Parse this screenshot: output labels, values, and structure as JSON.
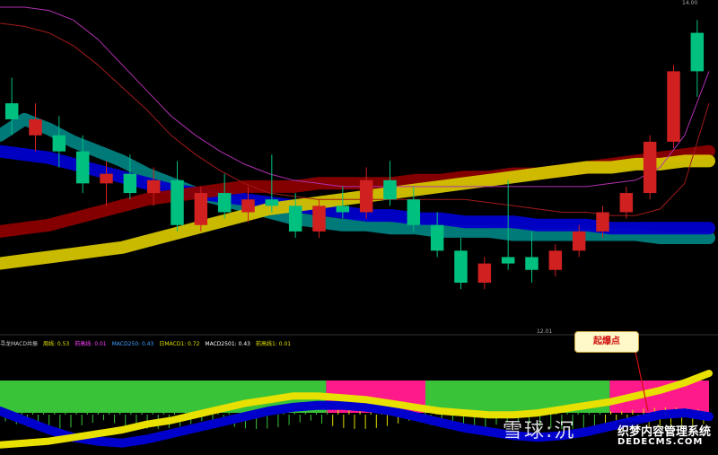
{
  "chart_data": [
    {
      "type": "line",
      "panel": "price",
      "title": "",
      "xlabel": "",
      "ylabel": "",
      "price_labels": {
        "high": "14.00",
        "low": "12.01"
      },
      "bands": [
        {
          "color": "#008080",
          "values": [
            60,
            65,
            62,
            58,
            55,
            52,
            48,
            45,
            42,
            40,
            38,
            36,
            34,
            33,
            32,
            32,
            31,
            31,
            30,
            30,
            30,
            29,
            29,
            29,
            29,
            29,
            29,
            28,
            28,
            28
          ]
        },
        {
          "color": "#0000cc",
          "values": [
            55,
            54,
            53,
            51,
            49,
            47,
            45,
            43,
            42,
            41,
            40,
            39,
            38,
            37,
            36,
            35,
            35,
            34,
            34,
            33,
            33,
            33,
            32,
            32,
            32,
            31,
            31,
            31,
            31,
            31
          ]
        },
        {
          "color": "#8b0000",
          "values": [
            30,
            31,
            32,
            34,
            36,
            38,
            40,
            41,
            42,
            43,
            44,
            44,
            44,
            45,
            45,
            45,
            45,
            46,
            46,
            47,
            47,
            48,
            48,
            49,
            50,
            51,
            52,
            53,
            54,
            55
          ]
        },
        {
          "color": "#d4c400",
          "values": [
            20,
            21,
            22,
            23,
            24,
            25,
            27,
            29,
            31,
            33,
            35,
            37,
            38,
            39,
            40,
            41,
            42,
            43,
            44,
            45,
            46,
            47,
            48,
            49,
            50,
            50,
            51,
            51,
            52,
            52
          ]
        }
      ],
      "series": [
        {
          "color": "#b030b0",
          "values": [
            100,
            100,
            99,
            96,
            90,
            82,
            74,
            66,
            60,
            55,
            51,
            48,
            46,
            45,
            44,
            44,
            44,
            44,
            44,
            44,
            44,
            44,
            44,
            44,
            44,
            45,
            46,
            50,
            60,
            80
          ]
        },
        {
          "color": "#a01a1a",
          "values": [
            95,
            94,
            92,
            88,
            82,
            75,
            68,
            60,
            54,
            49,
            45,
            42,
            41,
            40,
            40,
            40,
            40,
            40,
            40,
            40,
            39,
            38,
            37,
            36,
            36,
            35,
            35,
            37,
            45,
            70
          ]
        }
      ],
      "candles": [
        {
          "c": "#00c080",
          "o": 70,
          "h": 78,
          "l": 60,
          "cl": 65
        },
        {
          "c": "#d02020",
          "o": 65,
          "h": 70,
          "l": 55,
          "cl": 60
        },
        {
          "c": "#00c080",
          "o": 60,
          "h": 66,
          "l": 50,
          "cl": 55
        },
        {
          "c": "#00c080",
          "o": 55,
          "h": 60,
          "l": 42,
          "cl": 45
        },
        {
          "c": "#d02020",
          "o": 45,
          "h": 52,
          "l": 38,
          "cl": 48
        },
        {
          "c": "#00c080",
          "o": 48,
          "h": 54,
          "l": 40,
          "cl": 42
        },
        {
          "c": "#d02020",
          "o": 42,
          "h": 50,
          "l": 38,
          "cl": 46
        },
        {
          "c": "#00c080",
          "o": 46,
          "h": 52,
          "l": 30,
          "cl": 32
        },
        {
          "c": "#d02020",
          "o": 32,
          "h": 44,
          "l": 30,
          "cl": 42
        },
        {
          "c": "#00c080",
          "o": 42,
          "h": 48,
          "l": 34,
          "cl": 36
        },
        {
          "c": "#d02020",
          "o": 36,
          "h": 44,
          "l": 33,
          "cl": 40
        },
        {
          "c": "#00c080",
          "o": 40,
          "h": 54,
          "l": 36,
          "cl": 38
        },
        {
          "c": "#00c080",
          "o": 38,
          "h": 42,
          "l": 28,
          "cl": 30
        },
        {
          "c": "#d02020",
          "o": 30,
          "h": 40,
          "l": 28,
          "cl": 38
        },
        {
          "c": "#00c080",
          "o": 38,
          "h": 44,
          "l": 34,
          "cl": 36
        },
        {
          "c": "#d02020",
          "o": 36,
          "h": 50,
          "l": 34,
          "cl": 46
        },
        {
          "c": "#00c080",
          "o": 46,
          "h": 52,
          "l": 38,
          "cl": 40
        },
        {
          "c": "#00c080",
          "o": 40,
          "h": 44,
          "l": 30,
          "cl": 32
        },
        {
          "c": "#00c080",
          "o": 32,
          "h": 36,
          "l": 22,
          "cl": 24
        },
        {
          "c": "#00c080",
          "o": 24,
          "h": 28,
          "l": 12,
          "cl": 14
        },
        {
          "c": "#d02020",
          "o": 14,
          "h": 22,
          "l": 12,
          "cl": 20
        },
        {
          "c": "#00c080",
          "o": 20,
          "h": 46,
          "l": 18,
          "cl": 22
        },
        {
          "c": "#00c080",
          "o": 22,
          "h": 30,
          "l": 14,
          "cl": 18
        },
        {
          "c": "#d02020",
          "o": 18,
          "h": 26,
          "l": 16,
          "cl": 24
        },
        {
          "c": "#d02020",
          "o": 24,
          "h": 32,
          "l": 22,
          "cl": 30
        },
        {
          "c": "#d02020",
          "o": 30,
          "h": 38,
          "l": 28,
          "cl": 36
        },
        {
          "c": "#d02020",
          "o": 36,
          "h": 44,
          "l": 34,
          "cl": 42
        },
        {
          "c": "#d02020",
          "o": 42,
          "h": 60,
          "l": 40,
          "cl": 58
        },
        {
          "c": "#d02020",
          "o": 58,
          "h": 82,
          "l": 56,
          "cl": 80
        },
        {
          "c": "#00c080",
          "o": 80,
          "h": 96,
          "l": 72,
          "cl": 92
        }
      ]
    },
    {
      "type": "area",
      "panel": "indicator",
      "title": "",
      "xlabel": "",
      "ylabel": "",
      "legend_items": [
        {
          "label": "寻龙MACD共振",
          "color": "#cccccc"
        },
        {
          "label": "周线: 0.53",
          "color": "#e0e000"
        },
        {
          "label": "前高线: 0.01",
          "color": "#ff40ff"
        },
        {
          "label": "MACD250: 0.43",
          "color": "#40a0ff"
        },
        {
          "label": "日MACD1: 0.72",
          "color": "#e0e000"
        },
        {
          "label": "MACD2501: 0.43",
          "color": "#ffffff"
        },
        {
          "label": "前高线1: 0.01",
          "color": "#e0e000"
        }
      ],
      "zones": [
        {
          "color": "#39c339",
          "from": 0,
          "to": 0.46
        },
        {
          "color": "#ff1a8c",
          "from": 0.46,
          "to": 0.6
        },
        {
          "color": "#39c339",
          "from": 0.6,
          "to": 0.86
        },
        {
          "color": "#ff1a8c",
          "from": 0.86,
          "to": 1
        }
      ],
      "blue_line": [
        40,
        30,
        20,
        12,
        8,
        6,
        10,
        16,
        22,
        28,
        34,
        40,
        44,
        46,
        46,
        44,
        40,
        34,
        28,
        22,
        18,
        14,
        12,
        14,
        18,
        24,
        30,
        36,
        38,
        34
      ],
      "yellow_line": [
        4,
        6,
        8,
        12,
        16,
        20,
        26,
        30,
        36,
        42,
        48,
        52,
        56,
        56,
        54,
        52,
        48,
        44,
        40,
        38,
        36,
        36,
        38,
        42,
        46,
        50,
        56,
        62,
        70,
        80
      ]
    }
  ],
  "callout": {
    "label": "起爆点",
    "color": "#d01010"
  },
  "watermark": {
    "site_text": "雪球:沉",
    "overlay_text": "织梦内容管理系统",
    "url_text": "DEDECMS.COM"
  },
  "colors": {
    "background": "#000000",
    "up_candle": "#d02020",
    "down_candle": "#00c080"
  }
}
